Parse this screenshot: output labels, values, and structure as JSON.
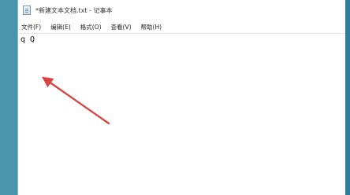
{
  "window": {
    "title": "*新建文本文档.txt - 记事本"
  },
  "menu": {
    "file": "文件(F)",
    "edit": "编辑(E)",
    "format": "格式(O)",
    "view": "查看(V)",
    "help": "帮助(H)"
  },
  "editor": {
    "text": "q Q"
  },
  "annotation": {
    "arrow_color": "#d9433f",
    "icon": "red-arrow-icon"
  }
}
